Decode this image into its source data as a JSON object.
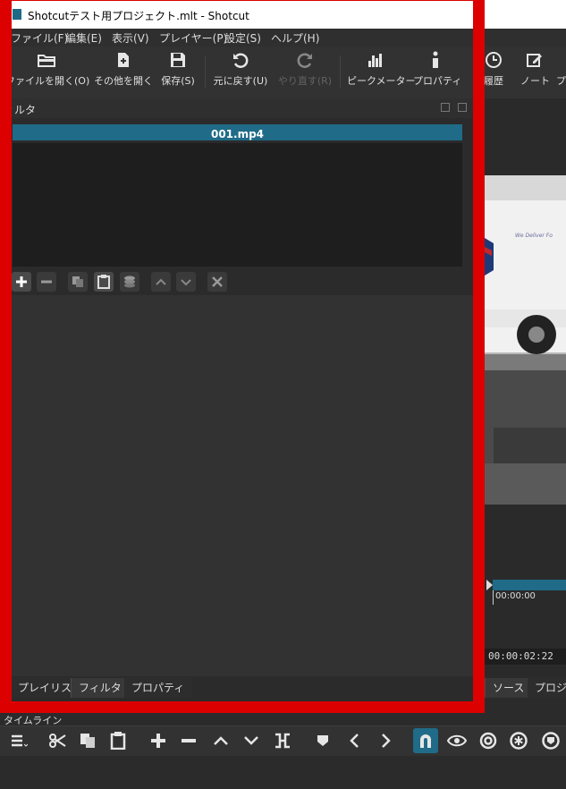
{
  "window": {
    "title": "Shotcutテスト用プロジェクト.mlt - Shotcut"
  },
  "menu": [
    "ファイル(F)",
    "編集(E)",
    "表示(V)",
    "プレイヤー(P)",
    "設定(S)",
    "ヘルプ(H)"
  ],
  "toolbar": {
    "open_file": "ファイルを開く(O)",
    "open_other": "その他を開く",
    "save": "保存(S)",
    "undo": "元に戻す(U)",
    "redo": "やり直す(R)",
    "peak_meter": "ピークメーター",
    "properties": "プロパティ",
    "history": "履歴",
    "notes": "ノート",
    "more": "プ"
  },
  "filter_panel": {
    "title": "ィルタ",
    "clip_name": "001.mp4"
  },
  "dock_tabs": [
    "プレイリスト",
    "フィルタ",
    "プロパティ"
  ],
  "preview_tabs": [
    "ソース",
    "プロジェ"
  ],
  "player": {
    "ruler_time": "00:00:00",
    "timecode": "00:00:02:22",
    "truck_text": "We Deliver Fo"
  },
  "timeline": {
    "label": "タイムライン"
  },
  "colors": {
    "accent": "#1f6b88",
    "highlight_frame": "#dd0000"
  }
}
